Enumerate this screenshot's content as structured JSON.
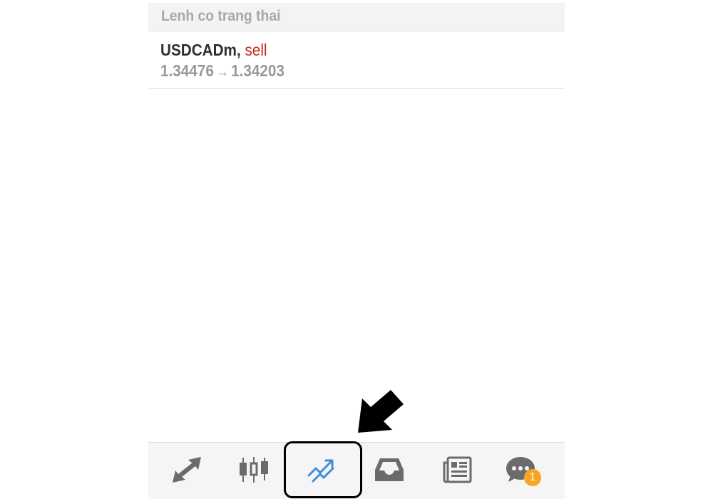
{
  "section": {
    "title": "Lenh co trang thai"
  },
  "orders": [
    {
      "symbol": "USDCADm,",
      "side": "sell",
      "open_price": "1.34476",
      "arrow": "→",
      "current_price": "1.34203"
    }
  ],
  "tabbar": {
    "tabs": [
      {
        "icon": "trade-arrows-icon"
      },
      {
        "icon": "candlestick-chart-icon"
      },
      {
        "icon": "trend-chart-icon",
        "active": true
      },
      {
        "icon": "inbox-icon"
      },
      {
        "icon": "news-icon"
      },
      {
        "icon": "chat-icon",
        "badge": "1"
      }
    ]
  },
  "colors": {
    "sell": "#c9251d",
    "active_icon": "#3d8fd6",
    "inactive_icon": "#6b6b6b",
    "badge": "#f5a623"
  }
}
